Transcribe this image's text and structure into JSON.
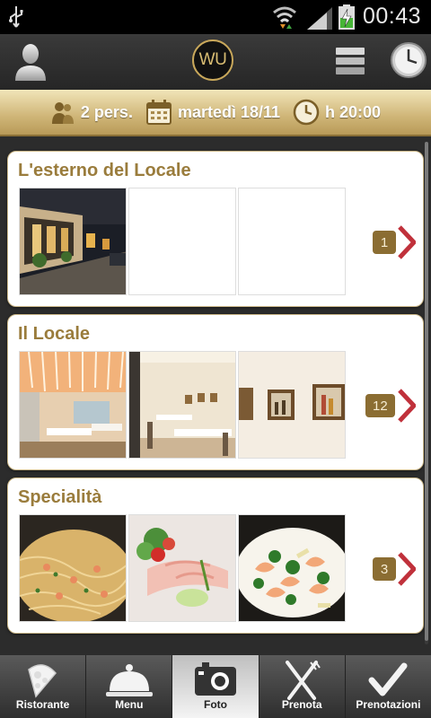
{
  "status_bar": {
    "time": "00:43"
  },
  "header": {
    "logo_text": "WU"
  },
  "booking": {
    "people": "2 pers.",
    "date": "martedì 18/11",
    "time": "h 20:00"
  },
  "sections": [
    {
      "title": "L'esterno del Locale",
      "count": "1"
    },
    {
      "title": "Il Locale",
      "count": "12"
    },
    {
      "title": "Specialità",
      "count": "3"
    }
  ],
  "tabs": [
    {
      "label": "Ristorante",
      "icon": "pizza-slice-icon"
    },
    {
      "label": "Menu",
      "icon": "cloche-icon"
    },
    {
      "label": "Foto",
      "icon": "camera-icon",
      "active": true
    },
    {
      "label": "Prenota",
      "icon": "cutlery-icon"
    },
    {
      "label": "Prenotazioni",
      "icon": "checkmark-icon"
    }
  ],
  "colors": {
    "accent_gold": "#c9a85b",
    "title_gold": "#9a7c3c",
    "badge_brown": "#8b6d32",
    "chevron_red": "#c0313b"
  }
}
